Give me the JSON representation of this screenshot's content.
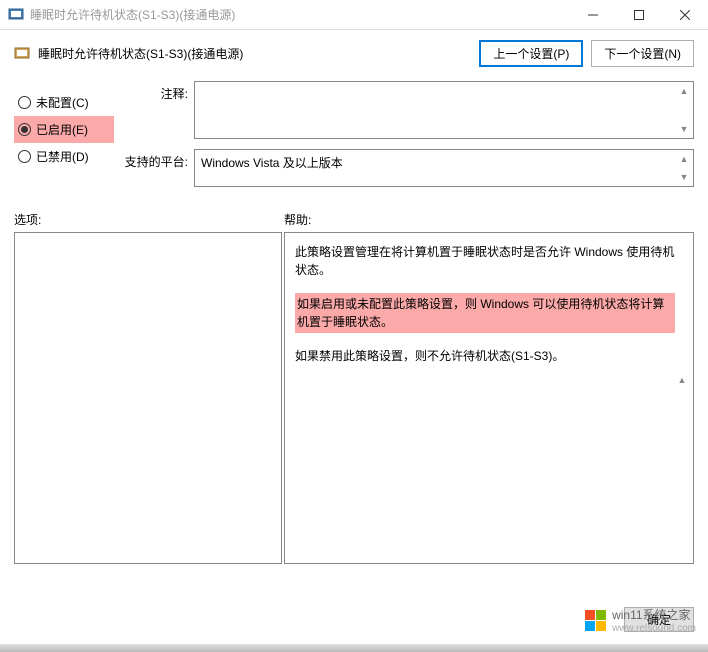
{
  "titlebar": {
    "text": "睡眠时允许待机状态(S1-S3)(接通电源)"
  },
  "header": {
    "title": "睡眠时允许待机状态(S1-S3)(接通电源)"
  },
  "nav": {
    "prev": "上一个设置(P)",
    "next": "下一个设置(N)"
  },
  "radios": {
    "not_configured": "未配置(C)",
    "enabled": "已启用(E)",
    "disabled": "已禁用(D)",
    "selected": "enabled"
  },
  "fields": {
    "comment_label": "注释:",
    "comment_value": "",
    "platform_label": "支持的平台:",
    "platform_value": "Windows Vista 及以上版本"
  },
  "labels": {
    "options": "选项:",
    "help": "帮助:"
  },
  "help": {
    "para1": "此策略设置管理在将计算机置于睡眠状态时是否允许 Windows 使用待机状态。",
    "para2": "如果启用或未配置此策略设置，则 Windows 可以使用待机状态将计算机置于睡眠状态。",
    "para3": "如果禁用此策略设置，则不允许待机状态(S1-S3)。"
  },
  "buttons": {
    "ok": "确定"
  },
  "watermark": {
    "brand": "win11系统之家",
    "url": "www.relsound.com"
  }
}
